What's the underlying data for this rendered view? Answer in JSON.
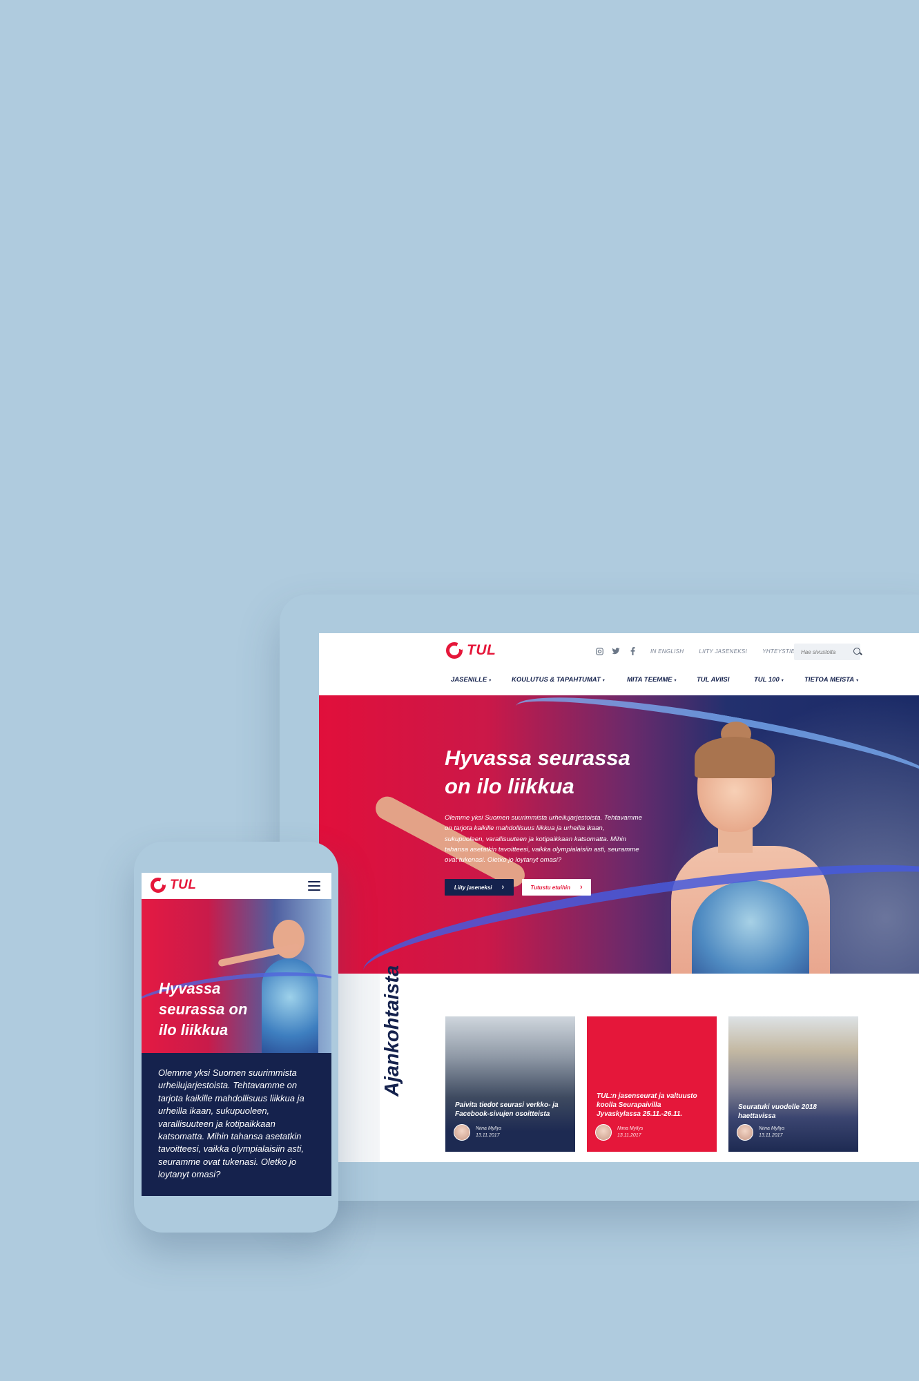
{
  "brand": {
    "name": "TUL",
    "color": "#e5173a",
    "navy": "#15224d",
    "background": "#afcbde"
  },
  "desktop": {
    "social_icons": [
      "instagram-icon",
      "twitter-icon",
      "facebook-icon"
    ],
    "utility_links": [
      "IN ENGLISH",
      "LIITY JASENEKSI",
      "YHTEYSTIEDOT"
    ],
    "search": {
      "placeholder": "Hae sivustolta"
    },
    "nav": [
      {
        "label": "JASENILLE",
        "dropdown": true
      },
      {
        "label": "KOULUTUS & TAPAHTUMAT",
        "dropdown": true
      },
      {
        "label": "MITA TEEMME",
        "dropdown": true
      },
      {
        "label": "TUL AVIISI",
        "dropdown": false
      },
      {
        "label": "TUL 100",
        "dropdown": true
      },
      {
        "label": "TIETOA MEISTA",
        "dropdown": true
      }
    ],
    "hero": {
      "title_line1": "Hyvassa seurassa",
      "title_line2": "on ilo liikkua",
      "text": "Olemme yksi Suomen suurimmista urheilujarjestoista. Tehtavamme on tarjota kaikille mahdollisuus liikkua ja urheilla ikaan, sukupuoleen, varallisuuteen ja kotipaikkaan katsomatta. Mihin tahansa asetatkin tavoitteesi, vaikka olympialaisiin asti, seuramme ovat tukenasi. Oletko jo loytanyt omasi?",
      "primary_button": "Liity jaseneksi",
      "secondary_button": "Tutustu etuihin"
    },
    "news": {
      "section_title": "Ajankohtaista",
      "cards": [
        {
          "title": "Paivita tiedot seurasi verkko- ja Facebook-sivujen osoitteista",
          "author": "Niina Myllys",
          "date": "13.11.2017"
        },
        {
          "title": "TUL:n jasenseurat ja valtuusto koolla Seurapaivilla Jyvaskylassa 25.11.-26.11.",
          "author": "Niina Myllys",
          "date": "13.11.2017"
        },
        {
          "title": "Seuratuki vuodelle 2018 haettavissa",
          "author": "Niina Myllys",
          "date": "13.11.2017"
        }
      ]
    }
  },
  "mobile": {
    "menu_icon": "hamburger-menu-icon",
    "hero_title": "Hyvassa seurassa on ilo liikkua",
    "text": "Olemme yksi Suomen suurimmista urheilujarjestoista. Tehtavamme on tarjota kaikille mahdollisuus liikkua ja urheilla ikaan, sukupuoleen, varallisuuteen ja kotipaikkaan katsomatta. Mihin tahansa asetatkin tavoitteesi, vaikka olympialaisiin asti, seuramme ovat tukenasi. Oletko jo loytanyt omasi?"
  }
}
